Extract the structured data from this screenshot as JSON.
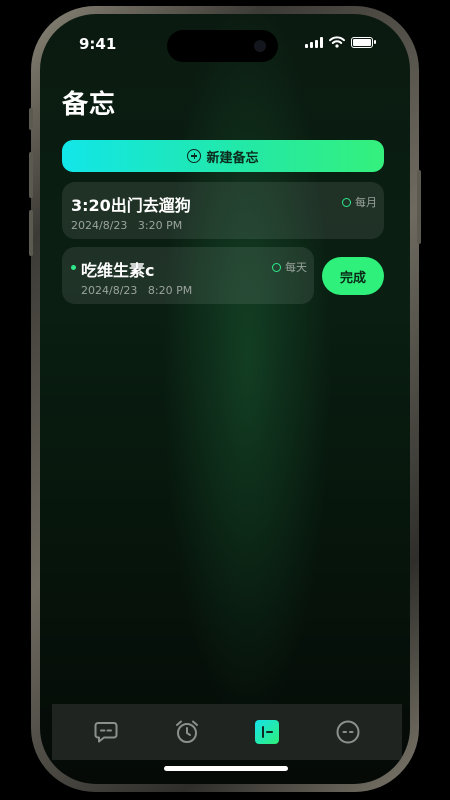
{
  "status_bar": {
    "time": "9:41"
  },
  "header": {
    "title": "备忘"
  },
  "actions": {
    "new_memo_label": "新建备忘"
  },
  "memos": [
    {
      "title": "3:20出门去遛狗",
      "date": "2024/8/23   3:20 PM",
      "repeat": "每月"
    },
    {
      "title": "吃维生素c",
      "date": "2024/8/23   8:20 PM",
      "repeat": "每天",
      "complete_label": "完成"
    }
  ],
  "tabbar": {
    "tabs": [
      {
        "name": "chat",
        "icon": "chat-bubble-icon",
        "active": false
      },
      {
        "name": "alarm",
        "icon": "alarm-clock-icon",
        "active": false
      },
      {
        "name": "memo",
        "icon": "memo-list-icon",
        "active": true
      },
      {
        "name": "profile",
        "icon": "face-icon",
        "active": false
      }
    ]
  },
  "colors": {
    "accent_green": "#2ef07a",
    "accent_cyan": "#12e6e8",
    "tabbar_bg": "#1f2420"
  }
}
